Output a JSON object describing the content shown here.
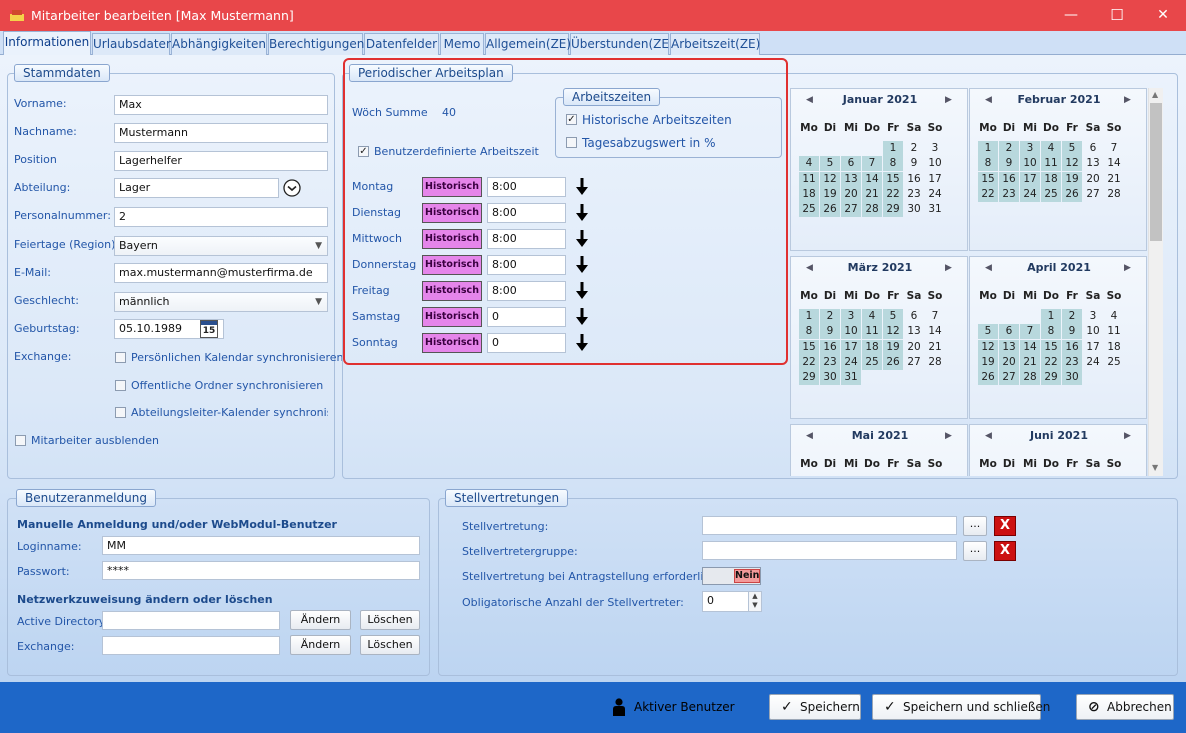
{
  "window": {
    "title": "Mitarbeiter bearbeiten [Max  Mustermann]",
    "minimize": "—",
    "maximize": "☐",
    "close": "✕"
  },
  "tabs": [
    {
      "label": "Informationen"
    },
    {
      "label": "Urlaubsdaten"
    },
    {
      "label": "Abhängigkeiten"
    },
    {
      "label": "Berechtigungen"
    },
    {
      "label": "Datenfelder"
    },
    {
      "label": "Memo"
    },
    {
      "label": "Allgemein(ZE)"
    },
    {
      "label": "Überstunden(ZE)"
    },
    {
      "label": "Arbeitszeit(ZE)"
    }
  ],
  "stammdaten": {
    "legend": "Stammdaten",
    "fields": [
      {
        "label": "Vorname:",
        "value": "Max"
      },
      {
        "label": "Nachname:",
        "value": "Mustermann"
      },
      {
        "label": "Position",
        "value": "Lagerhelfer"
      },
      {
        "label": "Abteilung:",
        "value": "Lager"
      },
      {
        "label": "Personalnummer:",
        "value": "2"
      },
      {
        "label": "Feiertage (Region):",
        "value": "Bayern"
      },
      {
        "label": "E-Mail:",
        "value": "max.mustermann@musterfirma.de"
      },
      {
        "label": "Geschlecht:",
        "value": "männlich"
      },
      {
        "label": "Geburtstag:",
        "value": "05.10.1989"
      }
    ],
    "calendar_icon_day": "15",
    "exchange_label": "Exchange:",
    "exchange_options": [
      {
        "label": "Persönlichen Kalendar synchronisieren",
        "checked": false
      },
      {
        "label": "Offentliche Ordner synchronisieren",
        "checked": false
      },
      {
        "label": "Abteilungsleiter-Kalender synchronisierer",
        "checked": false
      }
    ],
    "hide_employee": {
      "label": "Mitarbeiter ausblenden",
      "checked": false
    }
  },
  "arbeitsplan": {
    "legend": "Periodischer Arbeitsplan",
    "woech_summe_label": "Wöch Summe",
    "woech_summe_value": "40",
    "custom_worktime": {
      "label": "Benutzerdefinierte Arbeitszeit",
      "checked": true
    },
    "arbeitszeiten_legend": "Arbeitszeiten",
    "historische": {
      "label": "Historische Arbeitszeiten",
      "checked": true
    },
    "tagesabzug": {
      "label": "Tagesabzugswert in %",
      "checked": false
    },
    "historisch_label": "Historisch",
    "days": [
      {
        "label": "Montag",
        "value": "8:00"
      },
      {
        "label": "Dienstag",
        "value": "8:00"
      },
      {
        "label": "Mittwoch",
        "value": "8:00"
      },
      {
        "label": "Donnerstag",
        "value": "8:00"
      },
      {
        "label": "Freitag",
        "value": "8:00"
      },
      {
        "label": "Samstag",
        "value": "0"
      },
      {
        "label": "Sonntag",
        "value": "0"
      }
    ]
  },
  "calendar": {
    "weekdays": [
      "Mo",
      "Di",
      "Mi",
      "Do",
      "Fr",
      "Sa",
      "So"
    ],
    "months": [
      {
        "name": "Januar 2021",
        "offset": 4,
        "days": 31,
        "working": [
          1,
          4,
          5,
          6,
          7,
          8,
          11,
          12,
          13,
          14,
          15,
          18,
          19,
          20,
          21,
          22,
          25,
          26,
          27,
          28,
          29
        ]
      },
      {
        "name": "Februar 2021",
        "offset": 0,
        "days": 28,
        "working": [
          1,
          2,
          3,
          4,
          5,
          8,
          9,
          10,
          11,
          12,
          15,
          16,
          17,
          18,
          19,
          22,
          23,
          24,
          25,
          26
        ]
      },
      {
        "name": "März 2021",
        "offset": 0,
        "days": 31,
        "working": [
          1,
          2,
          3,
          4,
          5,
          8,
          9,
          10,
          11,
          12,
          15,
          16,
          17,
          18,
          19,
          22,
          23,
          24,
          25,
          26,
          29,
          30,
          31
        ]
      },
      {
        "name": "April 2021",
        "offset": 3,
        "days": 30,
        "working": [
          1,
          2,
          5,
          6,
          7,
          8,
          9,
          12,
          13,
          14,
          15,
          16,
          19,
          20,
          21,
          22,
          23,
          26,
          27,
          28,
          29,
          30
        ]
      },
      {
        "name": "Mai 2021",
        "offset": 5,
        "days": 0,
        "working": []
      },
      {
        "name": "Juni 2021",
        "offset": 1,
        "days": 0,
        "working": []
      }
    ]
  },
  "benutzeranmeldung": {
    "legend": "Benutzeranmeldung",
    "heading1": "Manuelle Anmeldung und/oder WebModul-Benutzer",
    "login_label": "Loginname:",
    "login_value": "MM",
    "password_label": "Passwort:",
    "password_value": "****",
    "heading2": "Netzwerkzuweisung ändern oder löschen",
    "ad_label": "Active Directory",
    "ad_value": "",
    "exchange_label": "Exchange:",
    "exchange_value": "",
    "change_label": "Ändern",
    "delete_label": "Löschen"
  },
  "stellvertretungen": {
    "legend": "Stellvertretungen",
    "stellvertretung_label": "Stellvertretung:",
    "stellvertretung_value": "",
    "gruppe_label": "Stellvertretergruppe:",
    "gruppe_value": "",
    "required_label": "Stellvertretung bei Antragstellung erforderlich:",
    "toggle_value": "Nein",
    "count_label": "Obligatorische Anzahl der Stellvertreter:",
    "count_value": "0",
    "browse_label": "...",
    "clear_label": "X"
  },
  "footer": {
    "status_label": "Aktiver Benutzer",
    "save_label": "Speichern",
    "save_close_label": "Speichern und schließen",
    "cancel_label": "Abbrechen"
  },
  "colors": {
    "titlebar": "#e8474a",
    "footer": "#1e67c8",
    "historisch": "#e585ea",
    "highlight": "#b8d8dd",
    "annotation": "#e03030"
  }
}
